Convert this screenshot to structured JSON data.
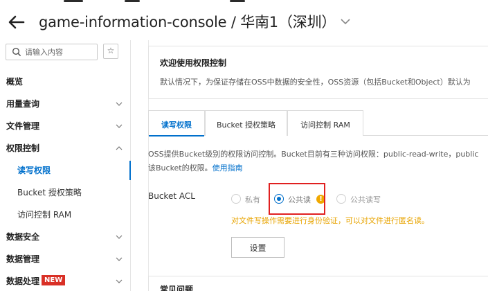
{
  "header": {
    "title": "game-information-console / 华南1（深圳）",
    "back_icon": "arrow-left-icon",
    "dropdown_icon": "chevron-down-icon"
  },
  "sidebar": {
    "search_placeholder": "请输入内容",
    "search_value": "",
    "favorite_icon": "star-icon",
    "items": [
      {
        "label": "概览",
        "level": 1
      },
      {
        "label": "用量查询",
        "level": 1,
        "chevron": "down"
      },
      {
        "label": "文件管理",
        "level": 1,
        "chevron": "down"
      },
      {
        "label": "权限控制",
        "level": 1,
        "chevron": "up"
      },
      {
        "label": "读写权限",
        "level": 2,
        "active": true
      },
      {
        "label": "Bucket 授权策略",
        "level": 2
      },
      {
        "label": "访问控制 RAM",
        "level": 2
      },
      {
        "label": "数据安全",
        "level": 1,
        "chevron": "down"
      },
      {
        "label": "数据管理",
        "level": 1,
        "chevron": "down"
      },
      {
        "label": "数据处理",
        "level": 1,
        "chevron": "down",
        "badge": "NEW"
      }
    ]
  },
  "welcome": {
    "title": "欢迎使用权限控制",
    "description": "默认情况下，为保证存储在OSS中数据的安全性，OSS资源（包括Bucket和Object）默认为"
  },
  "tabs": [
    {
      "label": "读写权限",
      "active": true
    },
    {
      "label": "Bucket 授权策略",
      "active": false
    },
    {
      "label": "访问控制 RAM",
      "active": false
    }
  ],
  "intro": {
    "line1": "OSS提供Bucket级别的权限访问控制。Bucket目前有三种访问权限：public-read-write，public",
    "line2": "该Bucket的权限。",
    "guide_link": "使用指南"
  },
  "acl": {
    "label": "Bucket ACL",
    "options": [
      {
        "label": "私有",
        "checked": false
      },
      {
        "label": "公共读",
        "checked": true
      },
      {
        "label": "公共读写",
        "checked": false
      }
    ],
    "warning_icon": "warning-icon",
    "warning_text": "对文件写操作需要进行身份验证，可以对文件进行匿名读。",
    "save_label": "设置"
  },
  "faq": {
    "title": "常见问题"
  },
  "colors": {
    "accent": "#0070cc",
    "warning": "#e8a400",
    "highlight": "#e02020",
    "badge": "#d93026"
  }
}
